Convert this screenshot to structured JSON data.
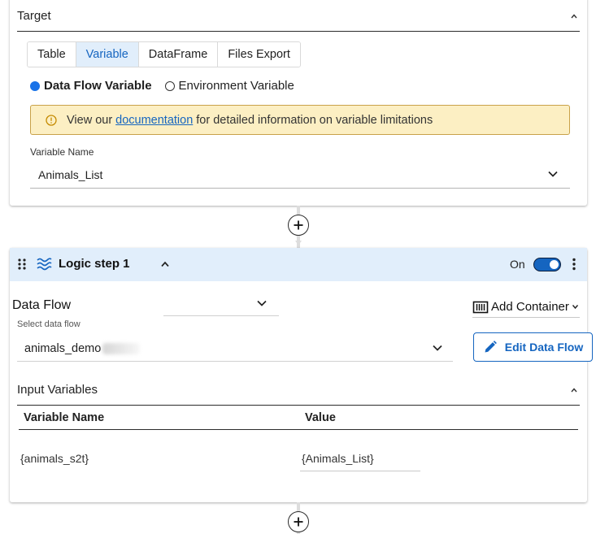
{
  "target": {
    "title": "Target",
    "tabs": [
      {
        "label": "Table",
        "active": false
      },
      {
        "label": "Variable",
        "active": true
      },
      {
        "label": "DataFrame",
        "active": false
      },
      {
        "label": "Files Export",
        "active": false
      }
    ],
    "radio": {
      "option_selected": "Data Flow Variable",
      "option_other": "Environment Variable"
    },
    "alert": {
      "prefix": "View our",
      "link_text": "documentation",
      "suffix": "for detailed information on variable limitations"
    },
    "variable_name": {
      "label": "Variable Name",
      "value": "Animals_List"
    }
  },
  "logic_step": {
    "title": "Logic step 1",
    "toggle_label": "On",
    "toggle_on": true,
    "data_flow_label": "Data Flow",
    "add_container_label": "Add Container",
    "select_data_flow": {
      "label": "Select data flow",
      "value": "animals_demo"
    },
    "edit_button_label": "Edit Data Flow",
    "input_variables": {
      "title": "Input Variables",
      "columns": [
        "Variable Name",
        "Value"
      ],
      "rows": [
        {
          "name": "{animals_s2t}",
          "value": "{Animals_List}"
        }
      ]
    }
  },
  "colors": {
    "accent": "#1565c0",
    "header_bg": "#e1eefb",
    "alert_bg": "#fcefc3",
    "alert_border": "#c9a24a"
  },
  "icons": [
    "chevron-up-icon",
    "chevron-down-icon",
    "warning-icon",
    "plus-icon",
    "drag-handle-icon",
    "logic-wave-icon",
    "kebab-menu-icon",
    "container-icon",
    "pencil-icon"
  ]
}
